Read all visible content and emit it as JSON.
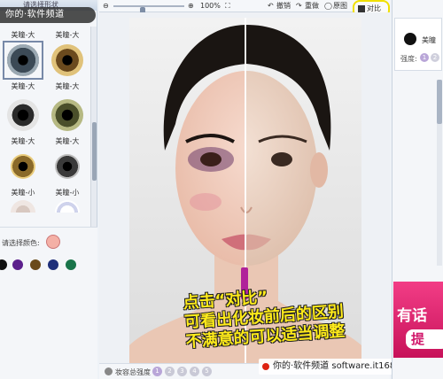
{
  "left_panel": {
    "title": "请选择形状",
    "watermark": "你的·软件频道",
    "lenses": [
      {
        "label": "美瞳-大",
        "color": "#1c2430",
        "ring": "#5e6e7a"
      },
      {
        "label": "美瞳-大",
        "color": "#7a5a26",
        "ring": "#d8b86a"
      },
      {
        "label": "美瞳-大",
        "color": "#262626",
        "ring": "#cfcfcf"
      },
      {
        "label": "美瞳-大",
        "color": "#4a4f2a",
        "ring": "#a7ab6c"
      },
      {
        "label": "美瞳-小",
        "color": "#6e5a26",
        "ring": "#e2c070"
      },
      {
        "label": "美瞳-小",
        "color": "#3a3a3a",
        "ring": "#cfcfcf"
      }
    ],
    "color_label": "请选择颜色:",
    "swatches": [
      "#111111",
      "#5b1f8c",
      "#6a4a1a",
      "#1e2f7a",
      "#19744a"
    ]
  },
  "toolbar": {
    "zoom_percent": "100%",
    "undo": "撤销",
    "redo": "重做",
    "original": "原图",
    "compare": "对比"
  },
  "canvas": {
    "caption_lines": [
      "点击“对比”",
      "可看出化妆前后的区别",
      "不满意的可以适当调整"
    ]
  },
  "bottom_bar": {
    "label": "妆容总强度",
    "levels": [
      "1",
      "2",
      "3",
      "4",
      "5"
    ],
    "watermark": "你的·软件频道  software.it168.com"
  },
  "right_panel": {
    "item_label": "美瞳",
    "strength_label": "强度:",
    "strength_levels": [
      "1",
      "2"
    ],
    "ad_text": "有话",
    "ad_button": "提"
  }
}
